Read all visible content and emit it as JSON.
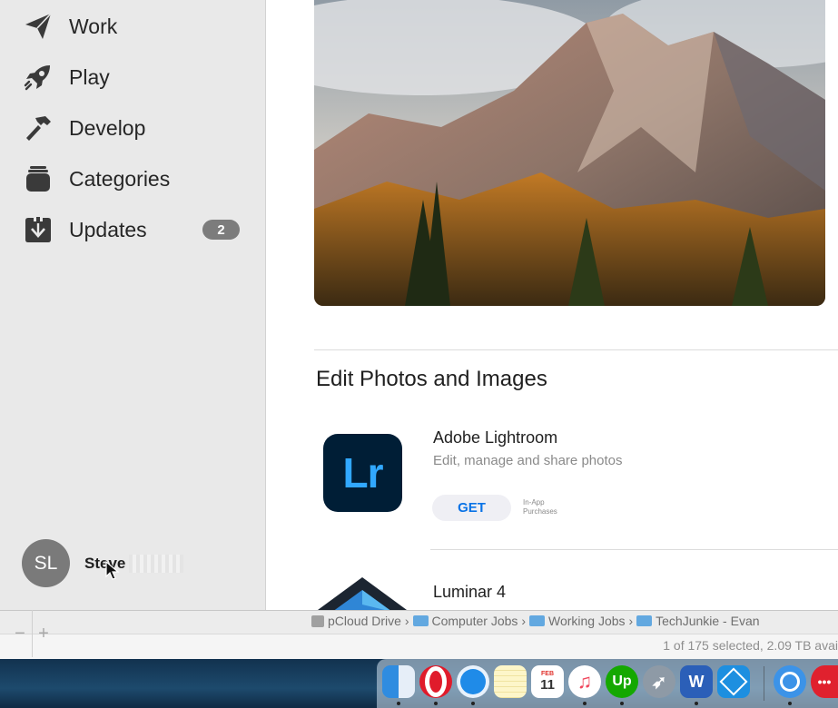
{
  "sidebar": {
    "items": [
      {
        "label": "Work",
        "icon": "paper-plane-icon"
      },
      {
        "label": "Play",
        "icon": "rocket-icon"
      },
      {
        "label": "Develop",
        "icon": "hammer-icon"
      },
      {
        "label": "Categories",
        "icon": "stack-icon"
      },
      {
        "label": "Updates",
        "icon": "download-icon",
        "badge": "2"
      }
    ],
    "user": {
      "initials": "SL",
      "name": "Steve"
    }
  },
  "main": {
    "section_title": "Edit Photos and Images",
    "apps": [
      {
        "icon_text": "Lr",
        "name": "Adobe Lightroom",
        "subtitle": "Edit, manage and share photos",
        "get_label": "GET",
        "iap_line1": "In-App",
        "iap_line2": "Purchases"
      },
      {
        "name": "Luminar 4"
      }
    ]
  },
  "finder": {
    "path": [
      "pCloud Drive",
      "Computer Jobs",
      "Working Jobs",
      "TechJunkie - Evan"
    ],
    "status": "1 of 175 selected, 2.09 TB avai",
    "minus": "−",
    "plus": "+"
  },
  "dock": {
    "calendar_month": "FEB",
    "calendar_day": "11",
    "upwork": "Up",
    "word": "W"
  },
  "colors": {
    "accent": "#0a73e6",
    "lightroom_bg": "#001e36",
    "lightroom_fg": "#31a8ff"
  }
}
